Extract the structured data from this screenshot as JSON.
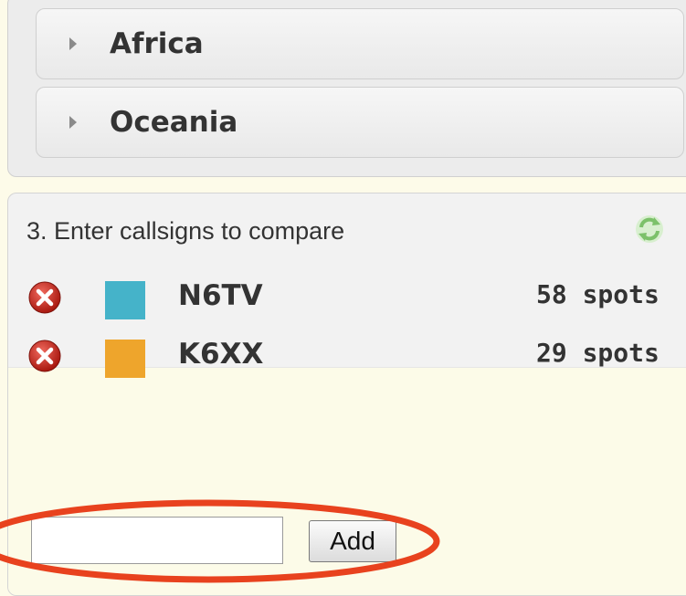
{
  "regions": {
    "items": [
      {
        "label": "Africa"
      },
      {
        "label": "Oceania"
      }
    ]
  },
  "compare": {
    "title": "3. Enter callsigns to compare",
    "callsigns": [
      {
        "callsign": "N6TV",
        "spots": "58 spots",
        "color": "#45b3c9"
      },
      {
        "callsign": "K6XX",
        "spots": "29 spots",
        "color": "#eea52c"
      }
    ],
    "input": {
      "value": "",
      "placeholder": ""
    },
    "add_label": "Add"
  },
  "annotation": {
    "color": "#e8421e"
  },
  "icons": {
    "refresh": "refresh-icon",
    "remove": "remove-icon",
    "expand": "triangle-right-icon"
  }
}
